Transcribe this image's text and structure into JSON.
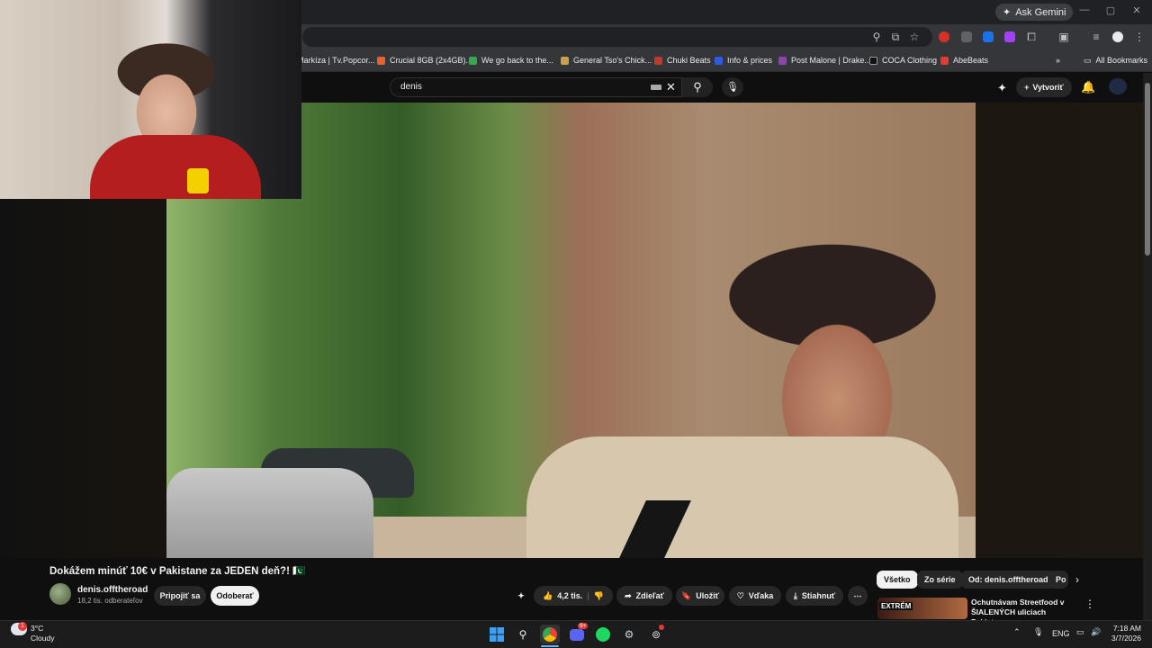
{
  "browser": {
    "gemini_label": "Ask Gemini",
    "bookmarks": [
      {
        "label": "Markíza | Tv.Popcor...",
        "color": "#4a90e2"
      },
      {
        "label": "Crucial 8GB (2x4GB)...",
        "color": "#e8632b"
      },
      {
        "label": "We go back to the...",
        "color": "#34a853"
      },
      {
        "label": "General Tso's Chick...",
        "color": "#c9a24a"
      },
      {
        "label": "Chuki Beats",
        "color": "#c0392b"
      },
      {
        "label": "Info & prices",
        "color": "#2b5fd9"
      },
      {
        "label": "Post Malone | Drake...",
        "color": "#8e44ad"
      },
      {
        "label": "COCA Clothing",
        "color": "#111111"
      },
      {
        "label": "AbeBeats",
        "color": "#e53935"
      }
    ],
    "all_bookmarks_label": "All Bookmarks"
  },
  "youtube": {
    "search_value": "denis",
    "create_label": "Vytvoriť",
    "video_title": "Dokážem minúť 10€ v Pakistane za JEDEN deň?! 🇵🇰",
    "channel_name": "denis.offtheroad",
    "subscribers": "18,2 tis. odberateľov",
    "join_label": "Pripojiť sa",
    "unsubscribe_label": "Odoberať",
    "likes": "4,2 tis.",
    "share_label": "Zdieľať",
    "save_label": "Uložiť",
    "thanks_label": "Vďaka",
    "download_label": "Stiahnuť",
    "chips": [
      "Všetko",
      "Zo série",
      "Od: denis.offtheroad",
      "Po"
    ],
    "recommendation": {
      "thumb_text": "EXTRÉM",
      "title": "Ochutnávam Streetfood v ŠIALENÝCH uliciach Pakistan..."
    }
  },
  "taskbar": {
    "weather_temp": "3°C",
    "weather_desc": "Cloudy",
    "weather_badge": "1",
    "language": "ENG",
    "time": "7:18 AM",
    "date": "3/7/2026",
    "discord_badge": "9+"
  }
}
